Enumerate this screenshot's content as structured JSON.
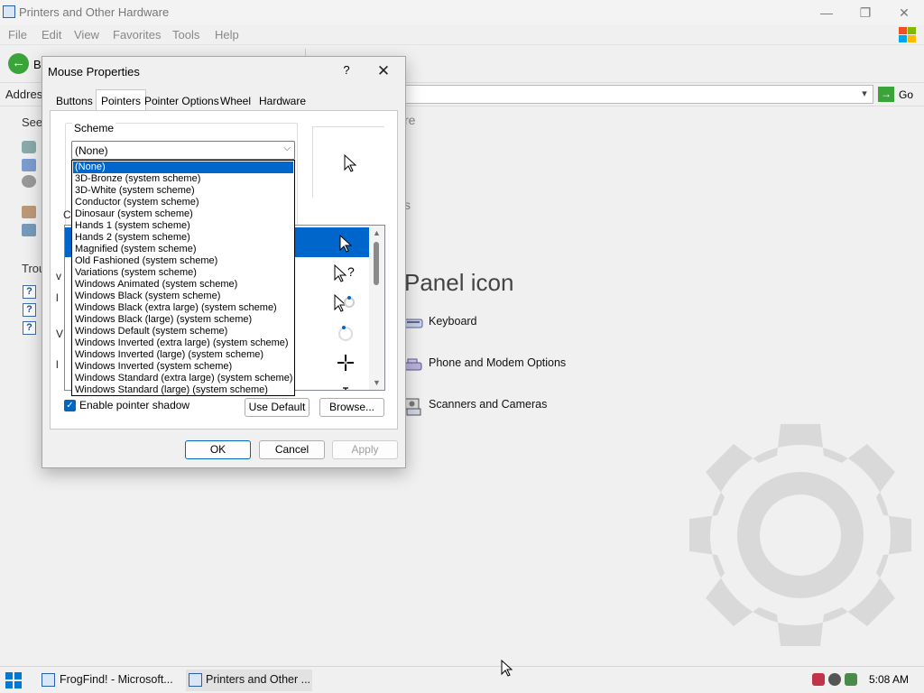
{
  "window": {
    "title": "Printers and Other Hardware",
    "controls": {
      "minimize": "—",
      "restore": "❐",
      "close": "✕"
    }
  },
  "menu": [
    "File",
    "Edit",
    "View",
    "Favorites",
    "Tools",
    "Help"
  ],
  "toolbar": {
    "back_label": "B"
  },
  "address": {
    "label": "Addres",
    "go_label": "Go"
  },
  "sidebar": {
    "see_also_heading": "See",
    "troubleshooters_heading": "Trou"
  },
  "background": {
    "frag_re": "re",
    "frag_s": "s",
    "panel_icon_title": "Panel icon",
    "items": [
      {
        "label": "Keyboard",
        "icon": "keyboard-icon"
      },
      {
        "label": "Phone and Modem Options",
        "icon": "phone-modem-icon"
      },
      {
        "label": "Scanners and Cameras",
        "icon": "scanner-camera-icon"
      }
    ]
  },
  "dialog": {
    "title": "Mouse Properties",
    "help": "?",
    "close": "✕",
    "tabs": [
      "Buttons",
      "Pointers",
      "Pointer Options",
      "Wheel",
      "Hardware"
    ],
    "selected_tab": "Pointers",
    "scheme_label": "Scheme",
    "scheme_value": "(None)",
    "customize_label": "C",
    "frag_letters": [
      "v",
      "l",
      "V",
      "l"
    ],
    "shadow_label": "Enable pointer shadow",
    "shadow_checked": true,
    "use_default_label": "Use Default",
    "browse_label": "Browse...",
    "ok_label": "OK",
    "cancel_label": "Cancel",
    "apply_label": "Apply"
  },
  "scheme_options": [
    "(None)",
    "3D-Bronze (system scheme)",
    "3D-White (system scheme)",
    "Conductor (system scheme)",
    "Dinosaur (system scheme)",
    "Hands 1 (system scheme)",
    "Hands 2 (system scheme)",
    "Magnified (system scheme)",
    "Old Fashioned (system scheme)",
    "Variations (system scheme)",
    "Windows Animated (system scheme)",
    "Windows Black  (system scheme)",
    "Windows Black (extra large) (system scheme)",
    "Windows Black (large) (system scheme)",
    "Windows Default (system scheme)",
    "Windows Inverted (extra large) (system scheme)",
    "Windows Inverted (large) (system scheme)",
    "Windows Inverted (system scheme)",
    "Windows Standard (extra large) (system scheme)",
    "Windows Standard (large) (system scheme)"
  ],
  "taskbar": {
    "items": [
      {
        "label": "FrogFind! - Microsoft...",
        "active": false
      },
      {
        "label": "Printers and Other ...",
        "active": true
      }
    ],
    "clock": "5:08 AM"
  },
  "colors": {
    "accent": "#0066cc",
    "checkbox": "#0067c0",
    "go_green": "#3aa33a"
  }
}
